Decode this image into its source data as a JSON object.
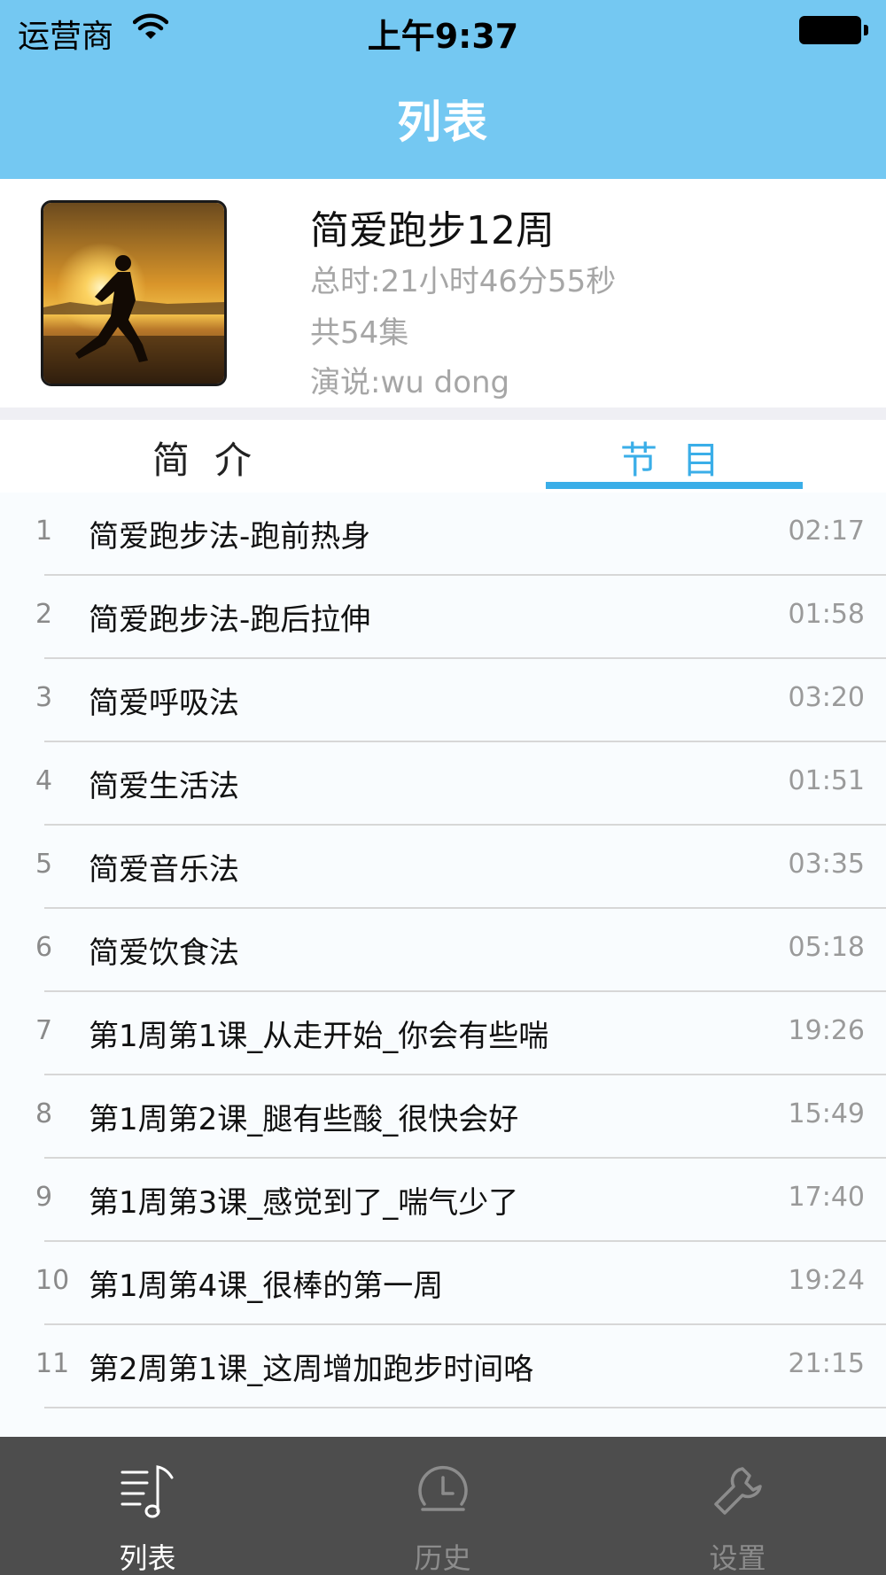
{
  "status_bar": {
    "carrier": "运营商",
    "time": "上午9:37"
  },
  "nav": {
    "title": "列表"
  },
  "album": {
    "title": "简爱跑步12周",
    "total_time": "总时:21小时46分55秒",
    "episode_count": "共54集",
    "narrator": "演说:wu dong"
  },
  "tabs": {
    "intro": "简介",
    "program": "节目"
  },
  "episodes": [
    {
      "num": "1",
      "name": "简爱跑步法-跑前热身",
      "duration": "02:17"
    },
    {
      "num": "2",
      "name": "简爱跑步法-跑后拉伸",
      "duration": "01:58"
    },
    {
      "num": "3",
      "name": "简爱呼吸法",
      "duration": "03:20"
    },
    {
      "num": "4",
      "name": "简爱生活法",
      "duration": "01:51"
    },
    {
      "num": "5",
      "name": "简爱音乐法",
      "duration": "03:35"
    },
    {
      "num": "6",
      "name": "简爱饮食法",
      "duration": "05:18"
    },
    {
      "num": "7",
      "name": "第1周第1课_从走开始_你会有些喘",
      "duration": "19:26"
    },
    {
      "num": "8",
      "name": "第1周第2课_腿有些酸_很快会好",
      "duration": "15:49"
    },
    {
      "num": "9",
      "name": "第1周第3课_感觉到了_喘气少了",
      "duration": "17:40"
    },
    {
      "num": "10",
      "name": "第1周第4课_很棒的第一周",
      "duration": "19:24"
    },
    {
      "num": "11",
      "name": "第2周第1课_这周增加跑步时间咯",
      "duration": "21:15"
    }
  ],
  "tabbar": {
    "items": [
      {
        "label": "列表",
        "icon": "music-list-icon",
        "active": true
      },
      {
        "label": "历史",
        "icon": "clock-icon",
        "active": false
      },
      {
        "label": "设置",
        "icon": "wrench-icon",
        "active": false
      }
    ]
  },
  "colors": {
    "nav_bg": "#74c8f2",
    "accent": "#3aaee8",
    "tabbar_bg": "#4d4d4d"
  }
}
